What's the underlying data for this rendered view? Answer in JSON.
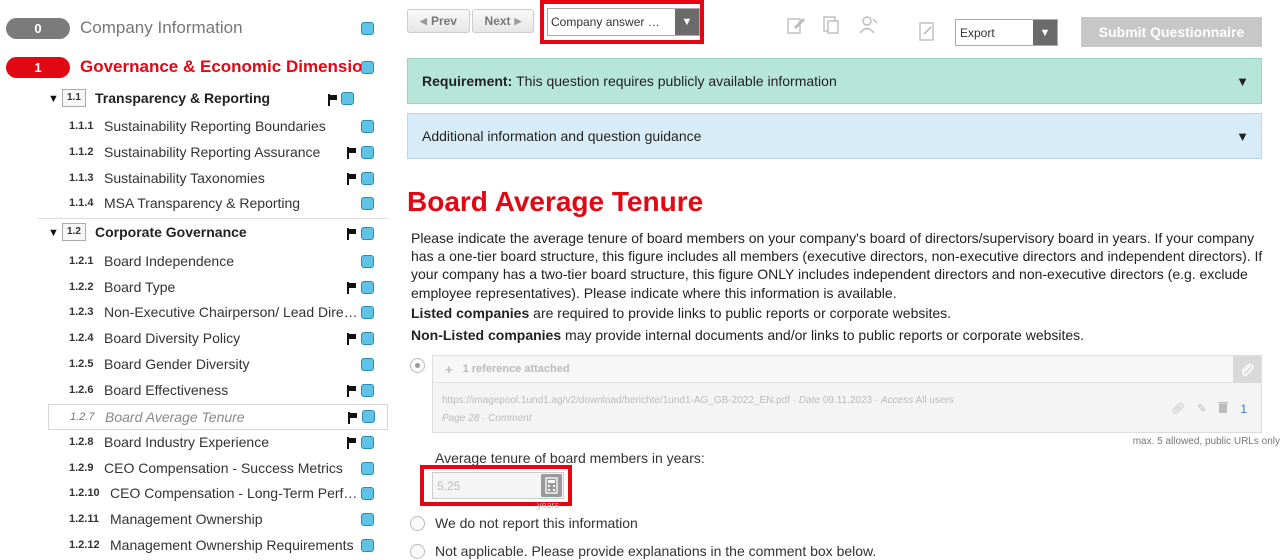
{
  "sidebar": {
    "sections": [
      {
        "number": "0",
        "title": "Company Information"
      },
      {
        "number": "1",
        "title": "Governance & Economic Dimension"
      }
    ],
    "subsections": [
      {
        "number": "1.1",
        "title": "Transparency & Reporting"
      },
      {
        "number": "1.2",
        "title": "Corporate Governance"
      }
    ],
    "items": [
      {
        "number": "1.1.1",
        "label": "Sustainability Reporting Boundaries"
      },
      {
        "number": "1.1.2",
        "label": "Sustainability Reporting Assurance"
      },
      {
        "number": "1.1.3",
        "label": "Sustainability Taxonomies"
      },
      {
        "number": "1.1.4",
        "label": "MSA Transparency & Reporting"
      },
      {
        "number": "1.2.1",
        "label": "Board Independence"
      },
      {
        "number": "1.2.2",
        "label": "Board Type"
      },
      {
        "number": "1.2.3",
        "label": "Non-Executive Chairperson/ Lead Dire…"
      },
      {
        "number": "1.2.4",
        "label": "Board Diversity Policy"
      },
      {
        "number": "1.2.5",
        "label": "Board Gender Diversity"
      },
      {
        "number": "1.2.6",
        "label": "Board Effectiveness"
      },
      {
        "number": "1.2.7",
        "label": "Board Average Tenure"
      },
      {
        "number": "1.2.8",
        "label": "Board Industry Experience"
      },
      {
        "number": "1.2.9",
        "label": "CEO Compensation - Success Metrics"
      },
      {
        "number": "1.2.10",
        "label": "CEO Compensation - Long-Term Perf…"
      },
      {
        "number": "1.2.11",
        "label": "Management Ownership"
      },
      {
        "number": "1.2.12",
        "label": "Management Ownership Requirements"
      }
    ]
  },
  "toolbar": {
    "prev_label": "Prev",
    "next_label": "Next",
    "answer_select": "Company answer …",
    "export_select": "Export",
    "submit_label": "Submit Questionnaire"
  },
  "panels": {
    "requirement_label": "Requirement:",
    "requirement_text": "This question requires publicly available information",
    "guidance_text": "Additional information and question guidance"
  },
  "question": {
    "title": "Board Average Tenure",
    "description": "Please indicate the average tenure of board members on your company's board of directors/supervisory board in years. If your company has a one-tier board structure, this figure includes all members (executive directors, non-executive directors and independent directors). If your company has a two-tier board structure, this figure ONLY includes independent directors and non-executive directors (e.g. exclude employee representatives). Please indicate where this information is available.",
    "listed_bold": "Listed companies",
    "listed_rest": " are required to provide links to public reports or corporate websites.",
    "nonlisted_bold": "Non-Listed companies",
    "nonlisted_rest": " may provide internal documents and/or links to public reports or corporate websites."
  },
  "reference": {
    "header": "1 reference attached",
    "url": "https://imagepool.1und1.ag/v2/download/berichte/1und1-AG_GB-2022_EN.pdf",
    "date_label": "Date",
    "date": "09.11.2023",
    "access_label": "Access",
    "access": "All users",
    "page": "Page 28",
    "comment": "Comment",
    "count": "1",
    "max_note": "max. 5 allowed, public URLs only"
  },
  "answer": {
    "label": "Average tenure of board members in years:",
    "value": "5.25",
    "unit": "years",
    "option_no_report": "We do not report this information",
    "option_na": "Not applicable. Please provide explanations in the comment box below."
  },
  "colors": {
    "accent_red": "#e30613",
    "requirement_bg": "#b6e6d8",
    "guidance_bg": "#d7ecf6",
    "status_square": "#5ec3e6"
  }
}
